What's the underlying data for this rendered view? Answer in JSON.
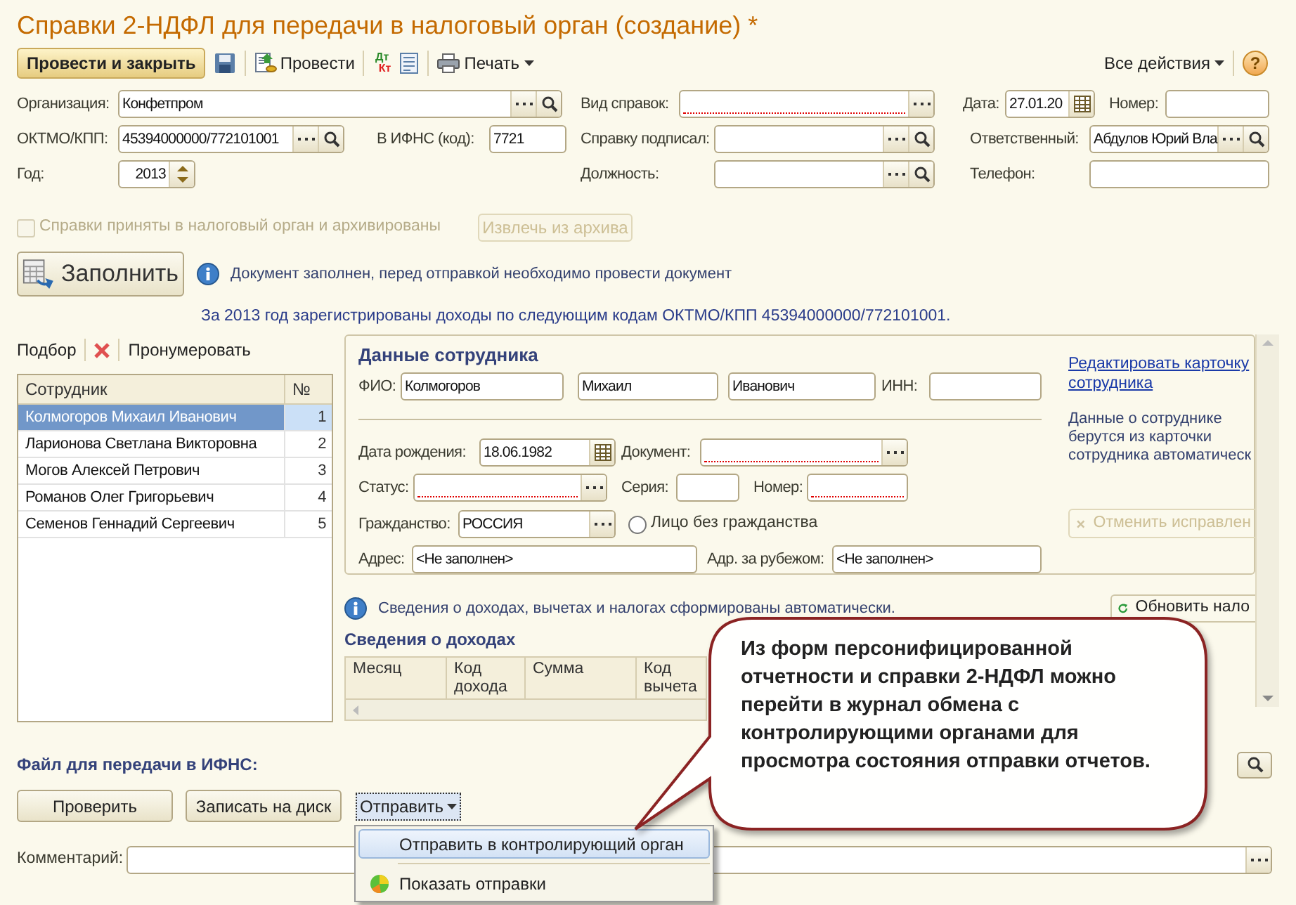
{
  "window": {
    "title": "Справки 2-НДФЛ для передачи в налоговый орган (создание) *"
  },
  "toolbar": {
    "post_close": "Провести и закрыть",
    "post": "Провести",
    "dt": "Дт",
    "kt": "Кт",
    "print": "Печать",
    "all_actions": "Все действия",
    "help": "?"
  },
  "header_rows": [
    [
      {
        "label": "Организация:",
        "value": "Конфетпром",
        "buttons": [
          {
            "kind": "select"
          },
          {
            "kind": "search"
          }
        ],
        "invalid": false
      },
      {
        "label": "Вид справок:",
        "buttons": [
          {
            "kind": "select"
          }
        ],
        "invalid": true
      },
      {
        "label": "Дата:",
        "value": "27.01.20",
        "buttons": [
          {
            "kind": "calendar"
          }
        ],
        "invalid": false
      },
      {
        "label": "Номер:",
        "invalid": false
      }
    ],
    [
      {
        "label": "ОКТМО/КПП:",
        "value": "45394000000/772101001",
        "buttons": [
          {
            "kind": "select"
          },
          {
            "kind": "search"
          }
        ],
        "invalid": false
      },
      {
        "label": "В ИФНС (код):",
        "value": "7721",
        "invalid": false
      },
      {
        "label": "Справку подписал:",
        "buttons": [
          {
            "kind": "select"
          },
          {
            "kind": "search"
          }
        ],
        "invalid": false
      },
      {
        "label": "Ответственный:",
        "value": "Абдулов Юрий Вла",
        "buttons": [
          {
            "kind": "select"
          },
          {
            "kind": "search"
          }
        ],
        "invalid": false
      }
    ],
    [
      {
        "label": "Год:",
        "value": "2013",
        "buttons": [
          {
            "kind": "spin"
          }
        ],
        "invalid": false
      },
      {
        "label": "Должность:",
        "buttons": [
          {
            "kind": "select"
          },
          {
            "kind": "search"
          }
        ],
        "invalid": false
      },
      {
        "label": "Телефон:",
        "invalid": false
      }
    ]
  ],
  "archive": {
    "label": "Справки приняты в налоговый орган и архивированы",
    "checked": false,
    "disabled": true
  },
  "extract_button": {
    "label": "Извлечь из архива",
    "disabled": true
  },
  "fill_button": "Заполнить",
  "fill_note": "Документ заполнен, перед отправкой необходимо провести документ",
  "income_note": "За 2013 год зарегистрированы доходы по следующим кодам ОКТМО/КПП 45394000000/772101001.",
  "employees": {
    "pick": "Подбор",
    "renumber": "Пронумеровать",
    "columns": [
      "Сотрудник",
      "№"
    ],
    "rows": [
      {
        "name": "Колмогоров Михаил Иванович",
        "number": "1",
        "selected": true
      },
      {
        "name": "Ларионова Светлана Викторовна",
        "number": "2",
        "selected": false
      },
      {
        "name": "Могов Алексей Петрович",
        "number": "3",
        "selected": false
      },
      {
        "name": "Романов Олег Григорьевич",
        "number": "4",
        "selected": false
      },
      {
        "name": "Семенов Геннадий Сергеевич",
        "number": "5",
        "selected": false
      }
    ]
  },
  "employee_card": {
    "title": "Данные сотрудника",
    "fields": [
      {
        "label": "ФИО:",
        "value": "Колмогоров",
        "invalid": false
      },
      {
        "value": "Михаил",
        "invalid": false
      },
      {
        "value": "Иванович",
        "invalid": false
      },
      {
        "label": "ИНН:",
        "invalid": false
      },
      {
        "label": "Дата рождения:",
        "value": "18.06.1982",
        "buttons": [
          {
            "kind": "calendar"
          }
        ],
        "invalid": false
      },
      {
        "label": "Документ:",
        "buttons": [
          {
            "kind": "select"
          }
        ],
        "invalid": true
      },
      {
        "label": "Статус:",
        "buttons": [
          {
            "kind": "select"
          }
        ],
        "invalid": true
      },
      {
        "label": "Серия:",
        "invalid": false
      },
      {
        "label": "Номер:",
        "invalid": true
      },
      {
        "label": "Гражданство:",
        "value": "РОССИЯ",
        "buttons": [
          {
            "kind": "select"
          }
        ],
        "invalid": false
      },
      {
        "label": "Адрес:",
        "value": "<Не заполнен>",
        "invalid": false
      },
      {
        "label": "Адр. за рубежом:",
        "value": "<Не заполнен>",
        "invalid": false
      }
    ],
    "stateless": {
      "label": "Лицо без гражданства",
      "selected": false
    },
    "edit_link": "Редактировать карточку сотрудника",
    "note": "Данные о сотруднике берутся из карточки сотрудника автоматическ",
    "cancel_button": {
      "label": "Отменить исправлен",
      "disabled": true
    }
  },
  "income_info": "Сведения о доходах, вычетах и налогах сформированы автоматически.",
  "refresh_button": "Обновить нало",
  "income": {
    "title": "Сведения о доходах",
    "columns": [
      "Месяц",
      "Код дохода",
      "Сумма",
      "Код вычета"
    ]
  },
  "file_section": {
    "title": "Файл для передачи в ИФНС:",
    "buttons": [
      "Проверить",
      "Записать на диск"
    ],
    "send": "Отправить",
    "menu": [
      {
        "label": "Отправить в контролирующий орган",
        "selected": true
      },
      {
        "label": "Показать отправки",
        "selected": false
      }
    ]
  },
  "comment": {
    "label": "Комментарий:"
  },
  "callout": "Из форм персонифицированной отчетности и справки 2-НДФЛ можно перейти в журнал обмена с контролирующими органами для просмотра состояния отправки отчетов."
}
